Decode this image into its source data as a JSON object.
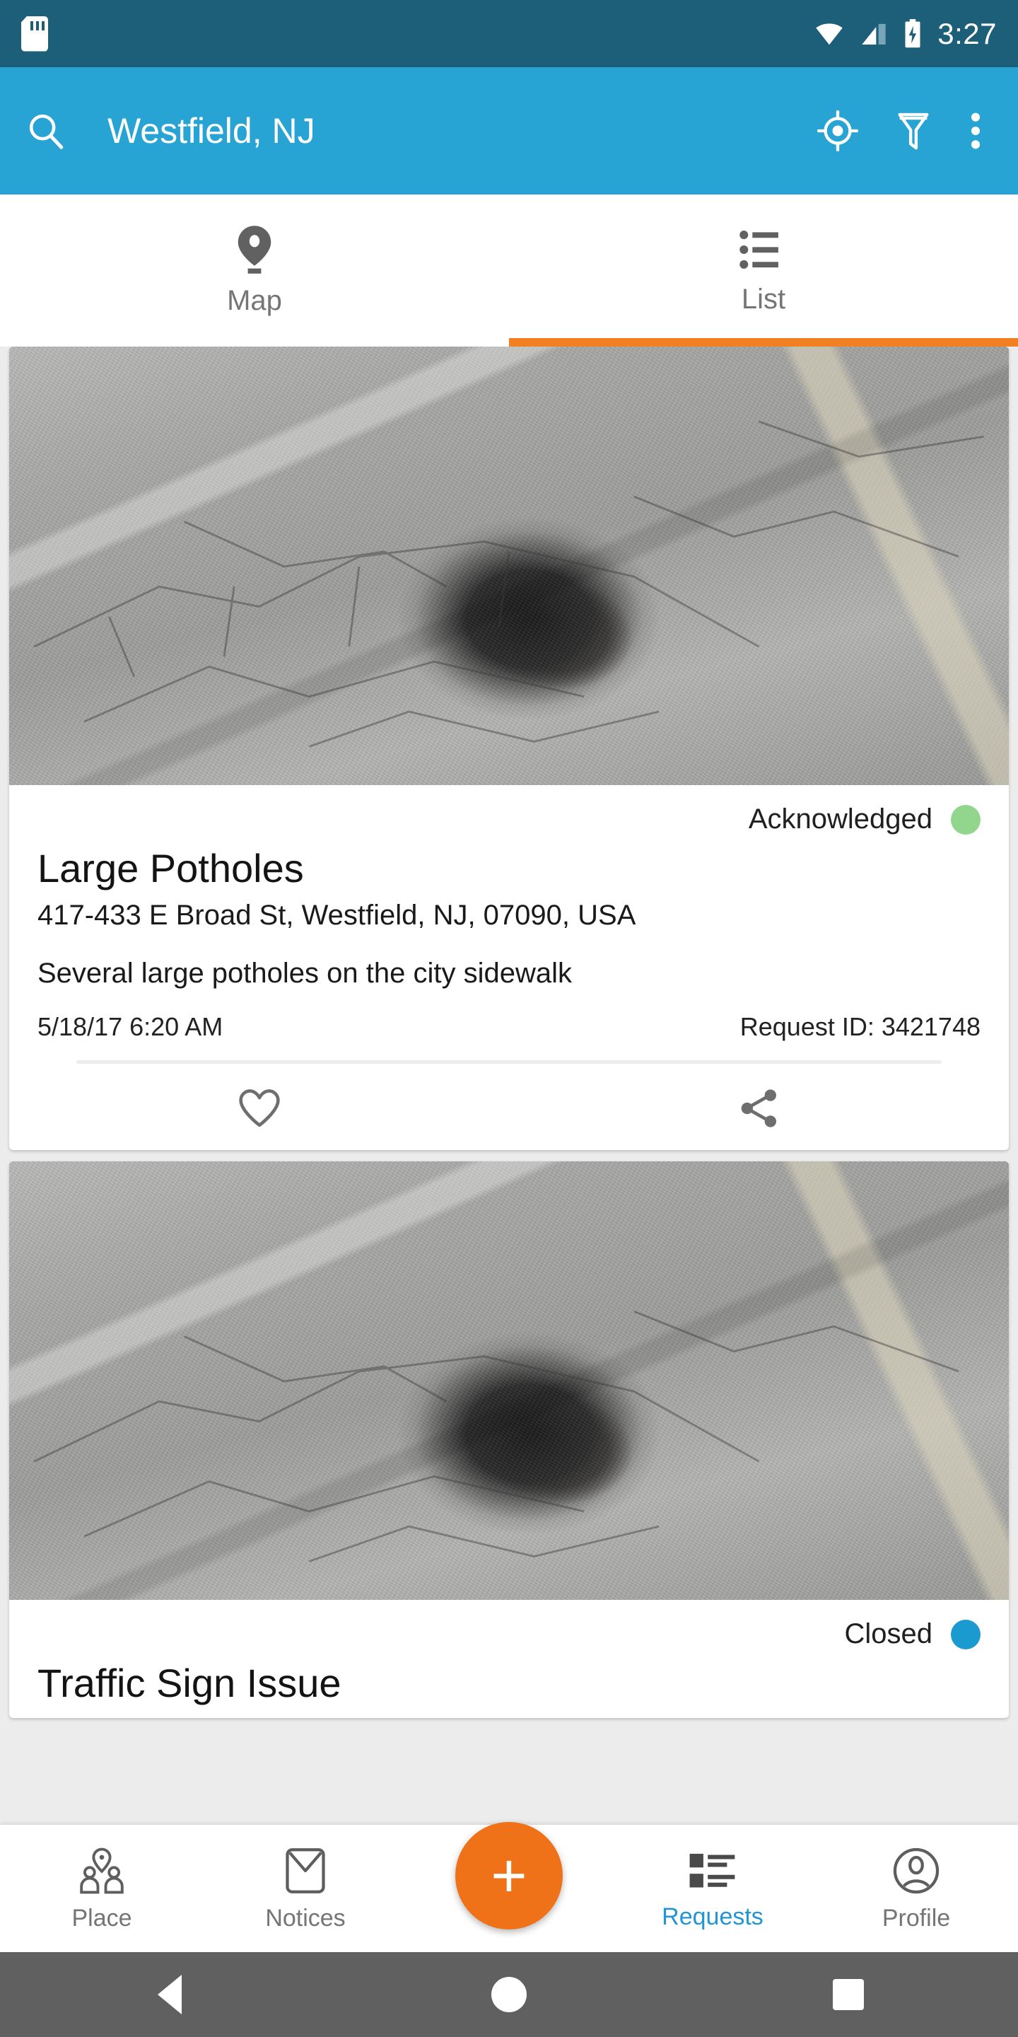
{
  "status_bar": {
    "sd_card_icon": "sd-card-icon",
    "wifi_icon": "wifi-icon",
    "signal_icon": "cellular-signal-icon",
    "battery_icon": "battery-charging-icon",
    "time": "3:27",
    "background_color": "#1D5F79"
  },
  "app_bar": {
    "search_icon": "search-icon",
    "title": "Westfield, NJ",
    "locate_icon": "my-location-icon",
    "filter_icon": "filter-funnel-icon",
    "overflow_icon": "more-vertical-icon",
    "background_color": "#27A3D4"
  },
  "tabs": {
    "indicator_color": "#F08021",
    "items": [
      {
        "label": "Map",
        "icon": "map-pin-icon",
        "active": false
      },
      {
        "label": "List",
        "icon": "list-icon",
        "active": true
      }
    ]
  },
  "requests": [
    {
      "photo_alt": "pothole-photo",
      "status": "Acknowledged",
      "status_color": "#92D68D",
      "title": "Large Potholes",
      "address": "417-433 E Broad St, Westfield, NJ, 07090, USA",
      "description": "Several large potholes on the city sidewalk",
      "date": "5/18/17 6:20 AM",
      "request_id": "Request ID: 3421748",
      "favorite_icon": "heart-icon",
      "share_icon": "share-icon"
    },
    {
      "photo_alt": "pothole-photo",
      "status": "Closed",
      "status_color": "#1B9AD0",
      "title": "Traffic Sign Issue"
    }
  ],
  "bottom_nav": {
    "fab_icon": "plus-icon",
    "fab_color": "#EF7219",
    "active_color": "#2196D3",
    "items": [
      {
        "label": "Place",
        "icon": "place-people-icon",
        "active": false
      },
      {
        "label": "Notices",
        "icon": "envelope-icon",
        "active": false
      },
      {
        "label": "Requests",
        "icon": "requests-list-icon",
        "active": true
      },
      {
        "label": "Profile",
        "icon": "profile-person-icon",
        "active": false
      }
    ]
  },
  "android_nav": {
    "back": "back-triangle-icon",
    "home": "home-circle-icon",
    "recents": "recents-square-icon"
  }
}
